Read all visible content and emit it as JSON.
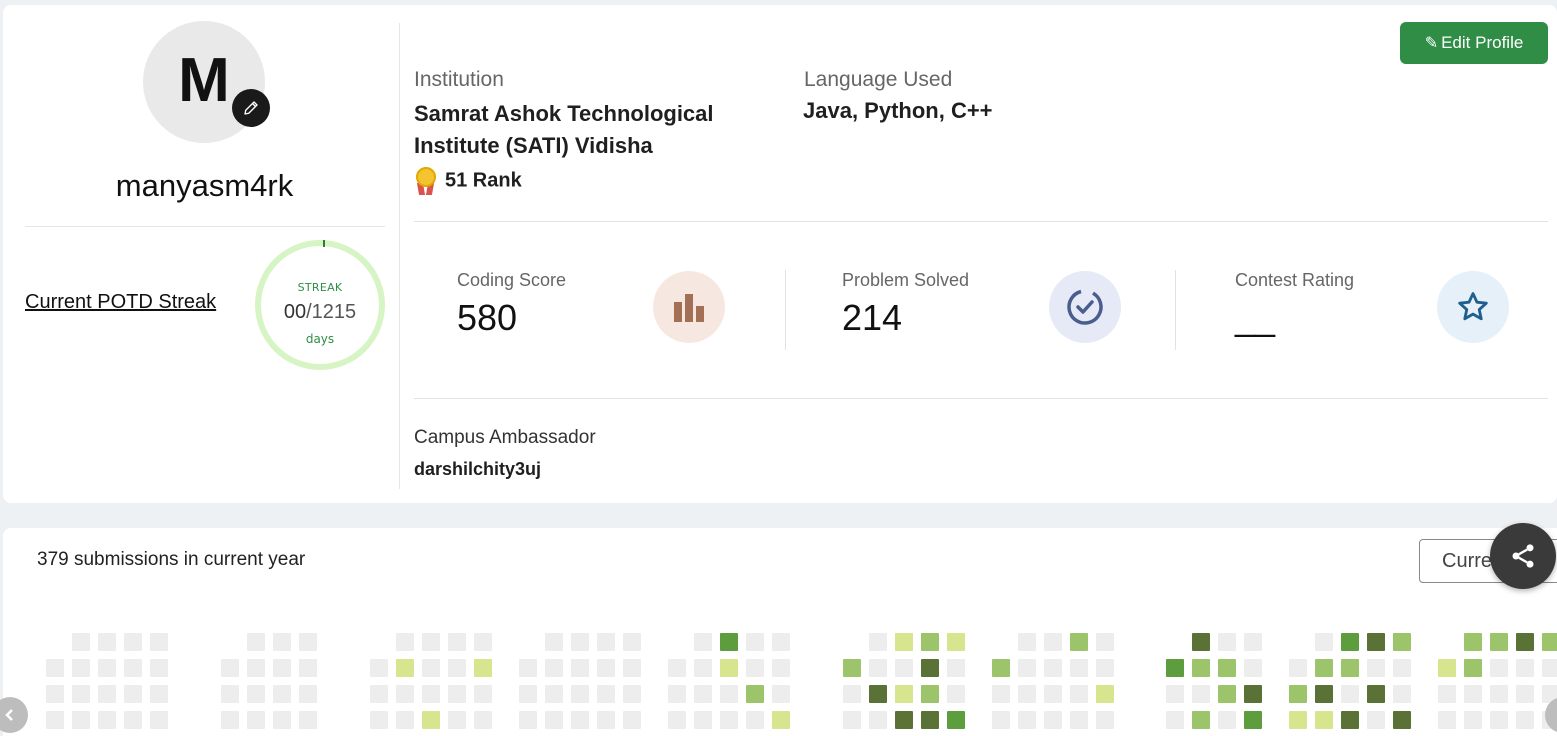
{
  "profile": {
    "avatar_letter": "M",
    "username": "manyasm4rk",
    "potd_label": "Current POTD Streak",
    "streak": {
      "label": "STREAK",
      "current": "00",
      "separator": "/",
      "total": "1215",
      "unit": "days",
      "progress_fraction": 0.0
    }
  },
  "actions": {
    "edit_profile_label": "Edit Profile"
  },
  "info": {
    "institution_label": "Institution",
    "institution_value": "Samrat Ashok Technological Institute (SATI) Vidisha",
    "rank_value": "51 Rank",
    "language_label": "Language Used",
    "language_value": "Java, Python, C++"
  },
  "stats": [
    {
      "label": "Coding Score",
      "value": "580",
      "icon": "bar-chart-icon"
    },
    {
      "label": "Problem Solved",
      "value": "214",
      "icon": "check-circle-icon"
    },
    {
      "label": "Contest Rating",
      "value": "__",
      "icon": "star-icon"
    }
  ],
  "ambassador": {
    "label": "Campus Ambassador",
    "value": "darshilchity3uj"
  },
  "submissions": {
    "summary": "379 submissions in current year",
    "year_select_value": "Curre"
  },
  "colors": {
    "brand_green": "#2f8d46",
    "heat_empty": "#ededed",
    "heat_1": "#d7e58e",
    "heat_2": "#9cc46b",
    "heat_3": "#5e9d3e",
    "heat_4": "#5a7236"
  },
  "heatmap_levels": [
    [
      null,
      0,
      0,
      0,
      0,
      null,
      0,
      0,
      0,
      0,
      null,
      0,
      0,
      0,
      0,
      0,
      null,
      0,
      0,
      0,
      3,
      null,
      0,
      0,
      0,
      1,
      null,
      2,
      1,
      0,
      0,
      2,
      null,
      0,
      4,
      0,
      0,
      null,
      0,
      3,
      4,
      2,
      null,
      2,
      2,
      4,
      2,
      0,
      null,
      2,
      0,
      0,
      2
    ],
    [
      0,
      0,
      0,
      0,
      0,
      0,
      0,
      0,
      0,
      0,
      1,
      0,
      0,
      1,
      0,
      0,
      0,
      0,
      0,
      0,
      0,
      1,
      0,
      0,
      2,
      0,
      0,
      4,
      0,
      2,
      0,
      0,
      0,
      0,
      3,
      2,
      2,
      0,
      0,
      2,
      2,
      0,
      0,
      1,
      2
    ],
    [
      0,
      0,
      0,
      0,
      0,
      0,
      0,
      0,
      0,
      0,
      0,
      0,
      0,
      0,
      0,
      0,
      0,
      0,
      0,
      0,
      0,
      0,
      2,
      0,
      0,
      4,
      1,
      2,
      0,
      0,
      0,
      0,
      0,
      1,
      0,
      0,
      2,
      4,
      2,
      4,
      0,
      4,
      0
    ],
    [
      0,
      0,
      0,
      0,
      0,
      0,
      0,
      0,
      0,
      0,
      0,
      1,
      0,
      0,
      0,
      0,
      0,
      0,
      0,
      0,
      0,
      0,
      0,
      1,
      0,
      0,
      4,
      4,
      3,
      0,
      0,
      0,
      0,
      0,
      0,
      2,
      0,
      3,
      1,
      1,
      4,
      0,
      4,
      0
    ]
  ]
}
